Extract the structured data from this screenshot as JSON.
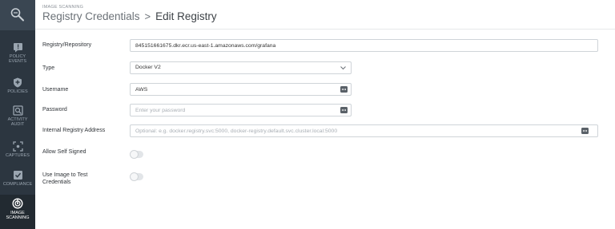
{
  "header": {
    "eyebrow": "IMAGE SCANNING",
    "breadcrumb_parent": "Registry Credentials",
    "breadcrumb_separator": ">",
    "breadcrumb_current": "Edit Registry"
  },
  "sidebar": {
    "logo_icon": "wrench-logo-icon",
    "items": [
      {
        "label": "POLICY EVENTS",
        "icon": "alert-icon",
        "active": false
      },
      {
        "label": "POLICIES",
        "icon": "shield-icon",
        "active": false
      },
      {
        "label": "ACTIVITY AUDIT",
        "icon": "audit-icon",
        "active": false
      },
      {
        "label": "CAPTURES",
        "icon": "capture-icon",
        "active": false
      },
      {
        "label": "COMPLIANCE",
        "icon": "compliance-icon",
        "active": false
      },
      {
        "label": "IMAGE SCANNING",
        "icon": "scan-icon",
        "active": true
      }
    ]
  },
  "form": {
    "registry": {
      "label": "Registry/Repository",
      "value": "845151661675.dkr.ecr.us-east-1.amazonaws.com/grafana"
    },
    "type": {
      "label": "Type",
      "value": "Docker V2"
    },
    "username": {
      "label": "Username",
      "value": "AWS"
    },
    "password": {
      "label": "Password",
      "value": "",
      "placeholder": "Enter your password"
    },
    "internal_address": {
      "label": "Internal Registry Address",
      "value": "",
      "placeholder": "Optional: e.g. docker.registry.svc:5000, docker-registry.default.svc.cluster.local:5000"
    },
    "allow_self_signed": {
      "label": "Allow Self Signed",
      "enabled": false
    },
    "use_image_test": {
      "label_line1": "Use Image to Test",
      "label_line2": "Credentials",
      "enabled": false
    }
  },
  "colors": {
    "sidebar_bg": "#2c3640",
    "sidebar_active": "#222a31",
    "field_border": "#cfd4d8",
    "toggle_off": "#e2e5e8"
  }
}
